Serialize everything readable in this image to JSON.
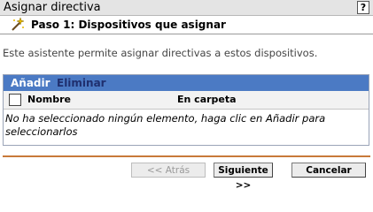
{
  "window": {
    "title": "Asignar directiva",
    "help_label": "?"
  },
  "step": {
    "title": "Paso 1: Dispositivos que asignar",
    "icon": "magic-wand-icon"
  },
  "description": "Este asistente permite asignar directivas a estos dispositivos.",
  "actions": {
    "add_label": "Añadir",
    "remove_label": "Eliminar"
  },
  "table": {
    "columns": [
      "Nombre",
      "En carpeta"
    ],
    "empty_message": "No ha seleccionado ningún elemento, haga clic en Añadir para seleccionarlos"
  },
  "buttons": {
    "back": "<< Atrás",
    "next": "Siguiente >>",
    "cancel": "Cancelar"
  },
  "colors": {
    "action_bar": "#4b7ac4",
    "divider": "#c87a3a"
  }
}
